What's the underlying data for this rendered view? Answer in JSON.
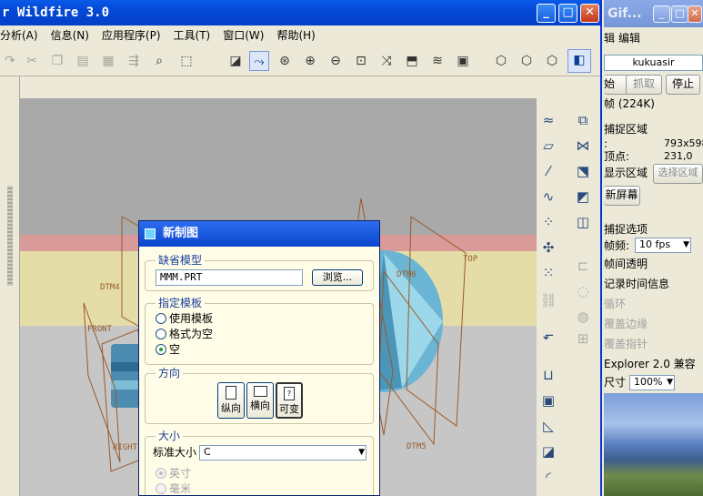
{
  "main_window": {
    "title": "r Wildfire 3.0",
    "title_buttons": {
      "minimize": "_",
      "maximize": "□",
      "close": "✕"
    },
    "menu": [
      "分析(A)",
      "信息(N)",
      "应用程序(P)",
      "工具(T)",
      "窗口(W)",
      "帮助(H)"
    ]
  },
  "canvas": {
    "datum_labels": [
      "DTM4",
      "FRONT",
      "RIGHT",
      "DTM6",
      "TOP",
      "DTM5"
    ],
    "colors": {
      "top_band": "#a9a9a9",
      "pink_band": "#d99a9a",
      "yellow_band": "#e4dda8",
      "bottom_band": "#c6c6c6",
      "datum": "#9a5a28",
      "model": "#4aa3c6"
    }
  },
  "dialog": {
    "title": "新制图",
    "default_model": {
      "label": "缺省模型",
      "value": "MMM.PRT",
      "browse": "浏览..."
    },
    "template": {
      "label": "指定模板",
      "options": [
        "使用模板",
        "格式为空",
        "空"
      ],
      "selected": "空"
    },
    "orientation": {
      "label": "方向",
      "buttons": [
        "纵向",
        "横向",
        "可变"
      ],
      "pressed": "可变"
    },
    "size": {
      "label": "大小",
      "std_label": "标准大小",
      "std_value": "C",
      "units": [
        "英寸",
        "毫米"
      ]
    }
  },
  "side_window": {
    "title": "Gif...",
    "menu": [
      "辑",
      "编辑"
    ],
    "name_field": "kukuasir",
    "buttons": [
      "始",
      "抓取",
      "停止"
    ],
    "frames": "帧 (224K)",
    "capture_area": "捕捉区域",
    "size_row": {
      "label": ":",
      "value": "793x598"
    },
    "vertex_row": {
      "label": "顶点:",
      "value": "231,0"
    },
    "show_area": "显示区域",
    "select_area": "选择区域",
    "new_screen": "新屏幕",
    "capture_options": "捕捉选项",
    "fps_label": "帧频:",
    "fps_value": "10 fps",
    "options": [
      "帧间透明",
      "记录时间信息",
      "循环",
      "覆盖边缘",
      "覆盖指针"
    ],
    "explorer": "Explorer 2.0 兼容",
    "zoom_label": "尺寸",
    "zoom_value": "100%"
  }
}
